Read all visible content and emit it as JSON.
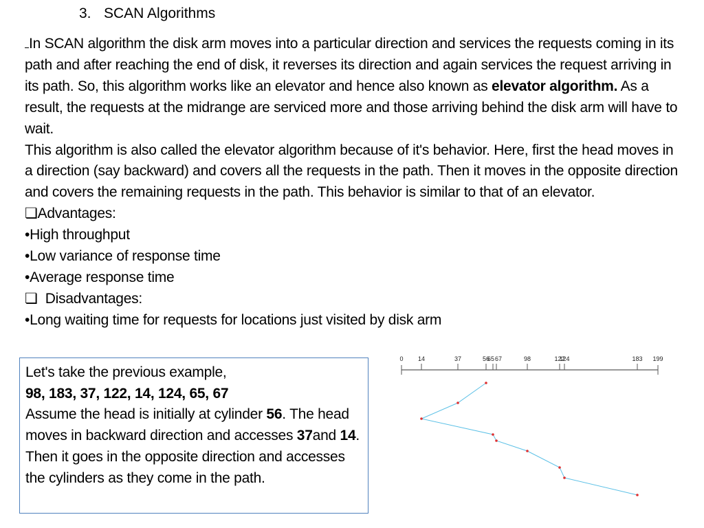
{
  "title": {
    "number": "3.",
    "text": "SCAN Algorithms"
  },
  "intro": {
    "p1_before": "In SCAN algorithm the disk arm moves into a particular direction and services the requests coming in its path and after reaching the end of disk, it reverses its direction and again services the request arriving in its path. So, this algorithm works like an elevator and hence also known as ",
    "p1_bold": "elevator algorithm.",
    "p1_after": " As a result, the requests at the midrange are serviced more and those arriving behind the disk arm will have to wait.",
    "p2": "This algorithm is also called the elevator algorithm because of it's behavior. Here, first the head moves in a direction (say backward) and covers all the requests in the path. Then it moves in the opposite direction and covers the remaining requests in the path. This behavior is similar to that of an elevator."
  },
  "advantages": {
    "checkbox_icon": "square-checkbox",
    "heading": "Advantages:",
    "items": [
      "•High throughput",
      "•Low variance of response time",
      "•Average response time"
    ]
  },
  "disadvantages": {
    "checkbox_icon": "square-checkbox",
    "heading": "Disadvantages:",
    "items": [
      "•Long waiting time for requests for locations just visited by disk arm"
    ]
  },
  "example": {
    "line1": "Let's take the previous example,",
    "sequence": "98, 183, 37, 122, 14, 124, 65, 67",
    "l3_before": "Assume the head is initially at cylinder ",
    "l3_bold": "56",
    "l3_after": ". The head moves in backward direction and accesses ",
    "b37": "37",
    "t_and": "and ",
    "b14": "14",
    "l_rest": ". Then it goes in the opposite direction and accesses the cylinders as they come in the path.",
    "border_color": "#4f81bd"
  },
  "chart_data": {
    "type": "line",
    "axis_ticks": [
      0,
      14,
      37,
      56,
      65,
      67,
      98,
      122,
      124,
      183,
      199
    ],
    "tick_labels": [
      "0",
      "14",
      "37",
      "56",
      "65",
      "67",
      "98",
      "122",
      "124",
      "183",
      "199"
    ],
    "xlim": [
      0,
      199
    ],
    "sequence": [
      56,
      37,
      14,
      65,
      67,
      98,
      122,
      124,
      183
    ],
    "line_color": "#5bc0e6",
    "point_color": "#e03030"
  }
}
